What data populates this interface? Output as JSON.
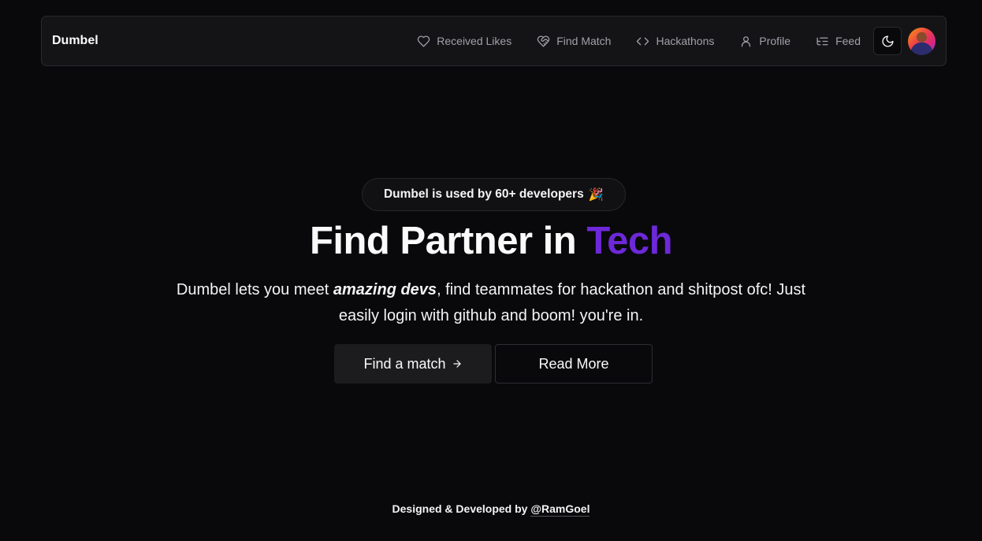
{
  "navbar": {
    "brand": "Dumbel",
    "links": [
      {
        "label": "Received Likes",
        "icon": "heart-icon"
      },
      {
        "label": "Find Match",
        "icon": "heart-handshake-icon"
      },
      {
        "label": "Hackathons",
        "icon": "code-icon"
      },
      {
        "label": "Profile",
        "icon": "user-icon"
      },
      {
        "label": "Feed",
        "icon": "list-tree-icon"
      }
    ],
    "theme_toggle_icon": "moon-icon",
    "avatar_icon": "user-avatar"
  },
  "hero": {
    "badge_text": "Dumbel is used by 60+ developers",
    "badge_emoji": "🎉",
    "title_main": "Find Partner in",
    "title_accent": "Tech",
    "desc_before": "Dumbel lets you meet ",
    "desc_emphasis": "amazing devs",
    "desc_after": ", find teammates for hackathon and shitpost ofc! Just easily login with github and boom! you're in.",
    "primary_button": "Find a match",
    "secondary_button": "Read More"
  },
  "footer": {
    "text": "Designed & Developed by",
    "author": "@RamGoel"
  },
  "colors": {
    "background": "#09090b",
    "accent": "#6d28d9",
    "navbar_bg": "#141416"
  }
}
